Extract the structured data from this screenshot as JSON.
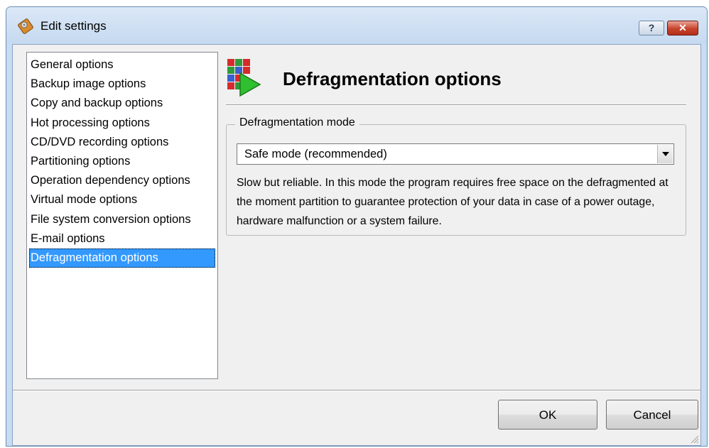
{
  "window": {
    "title": "Edit settings",
    "help_label": "?",
    "close_label": "✕"
  },
  "categories": [
    {
      "label": "General options"
    },
    {
      "label": "Backup image options"
    },
    {
      "label": "Copy and backup options"
    },
    {
      "label": "Hot processing options"
    },
    {
      "label": "CD/DVD recording options"
    },
    {
      "label": "Partitioning options"
    },
    {
      "label": "Operation dependency options"
    },
    {
      "label": "Virtual mode options"
    },
    {
      "label": "File system conversion options"
    },
    {
      "label": "E-mail options"
    },
    {
      "label": "Defragmentation options",
      "selected": true
    }
  ],
  "section": {
    "title": "Defragmentation options",
    "icon": "defragmentation-icon"
  },
  "defrag_mode": {
    "group_label": "Defragmentation mode",
    "selected_value": "Safe mode (recommended)",
    "description": "Slow but reliable. In this mode the program requires free space on the defragmented at the moment partition to guarantee protection of your data in case of a power outage, hardware malfunction or a system failure."
  },
  "buttons": {
    "ok": "OK",
    "cancel": "Cancel"
  },
  "colors": {
    "selection": "#3399ff",
    "title_bar": "#c8dcf2",
    "close_button": "#c7432b"
  }
}
